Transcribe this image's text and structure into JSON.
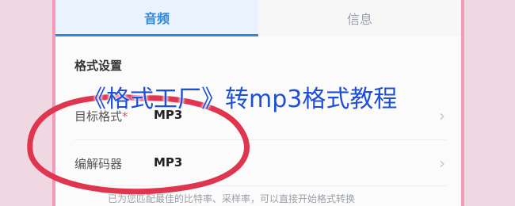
{
  "tabs": [
    {
      "label": "音频",
      "active": true
    },
    {
      "label": "信息",
      "active": false
    }
  ],
  "section": {
    "title": "格式设置"
  },
  "rows": [
    {
      "label": "目标格式",
      "required_mark": "*",
      "value": "MP3"
    },
    {
      "label": "编解码器",
      "required_mark": "",
      "value": "MP3"
    }
  ],
  "hint": "已为您匹配最佳的比特率、采样率，可以直接开始格式转换",
  "overlay": {
    "headline": "《格式工厂》转mp3格式教程"
  },
  "colors": {
    "accent": "#2f88df",
    "headline": "#1d4fd8",
    "annotation": "#e0354f"
  }
}
